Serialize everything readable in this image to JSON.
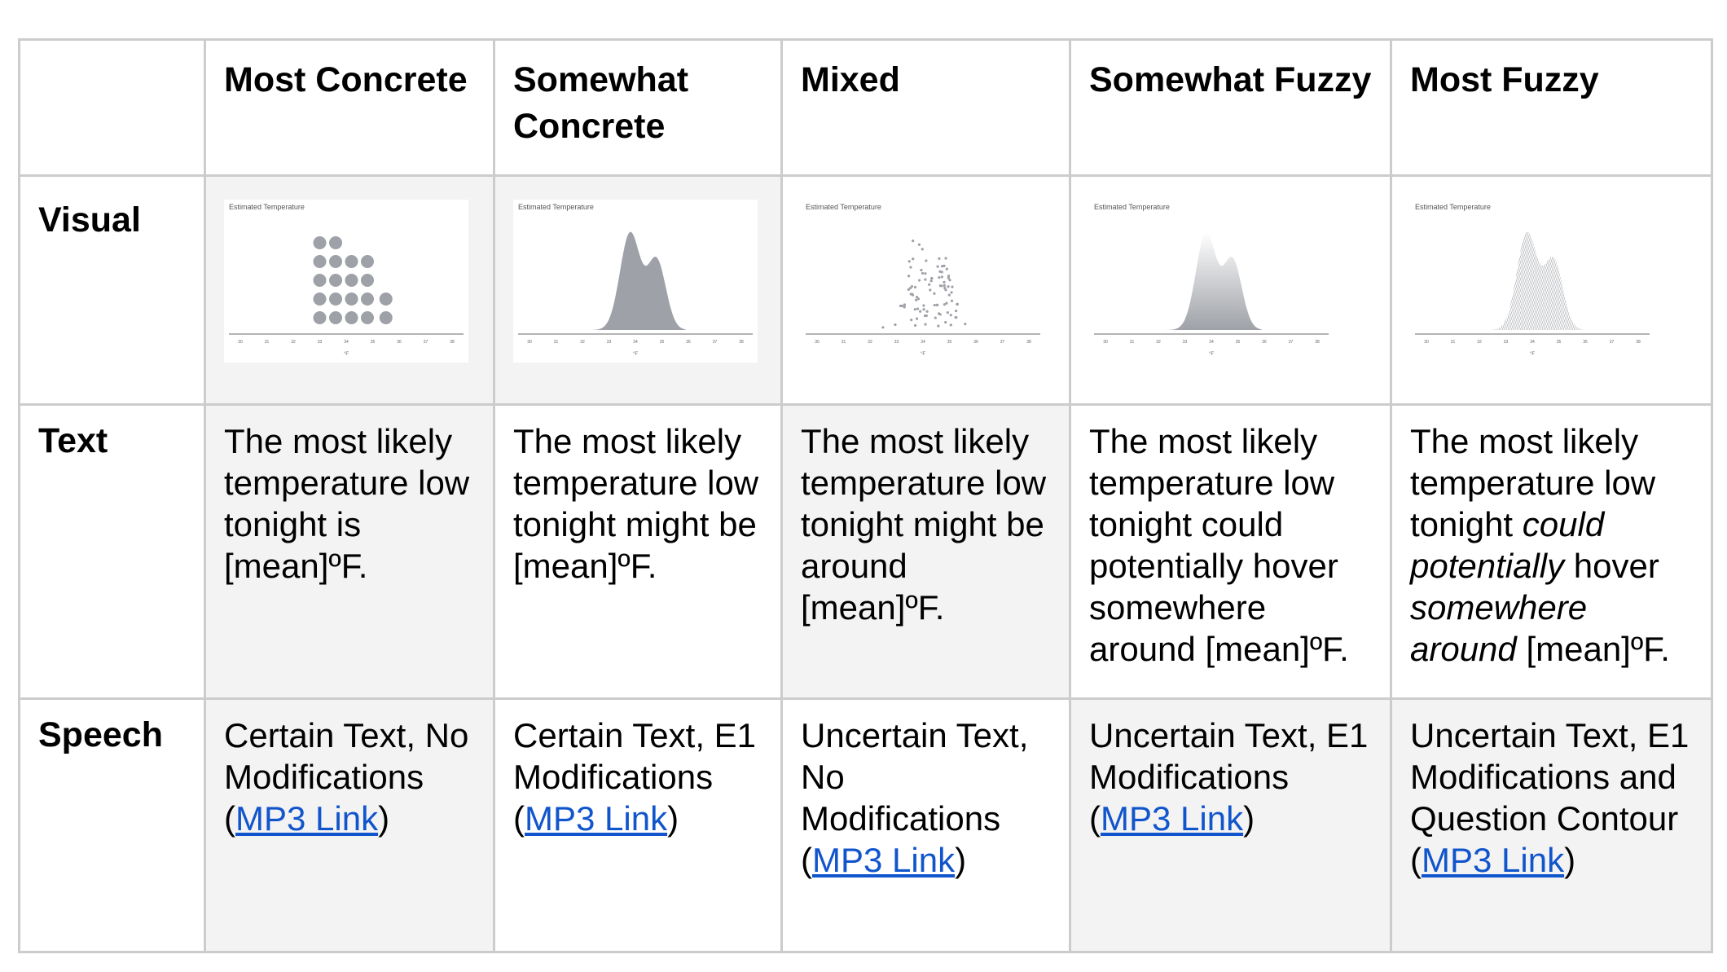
{
  "columns": [
    "Most Concrete",
    "Somewhat Concrete",
    "Mixed",
    "Somewhat Fuzzy",
    "Most Fuzzy"
  ],
  "rows": {
    "visual": "Visual",
    "text": "Text",
    "speech": "Speech"
  },
  "chart_common": {
    "title": "Estimated Temperature",
    "xlabel": "°F",
    "ticks": [
      "30",
      "31",
      "32",
      "33",
      "34",
      "35",
      "36",
      "37",
      "38"
    ],
    "xlim": [
      30,
      38
    ]
  },
  "visuals": [
    {
      "type": "dot-plot",
      "style": "solid circles",
      "color": "#9ea1a7",
      "columns": [
        {
          "x": 33.0,
          "count": 5
        },
        {
          "x": 33.6,
          "count": 5
        },
        {
          "x": 34.2,
          "count": 4
        },
        {
          "x": 34.8,
          "count": 4
        },
        {
          "x": 35.5,
          "count": 2
        }
      ]
    },
    {
      "type": "density",
      "style": "solid fill",
      "color": "#9ea1a7"
    },
    {
      "type": "scatter",
      "style": "jittered small dots",
      "color": "#9ea1a7"
    },
    {
      "type": "density",
      "style": "gradient fill",
      "color": "#9ea1a7"
    },
    {
      "type": "density",
      "style": "hatched scribble",
      "color": "#9ea1a7"
    }
  ],
  "texts": [
    [
      "The most likely temperature low tonight is [mean]ºF."
    ],
    [
      "The most likely temperature low tonight might be [mean]ºF."
    ],
    [
      "The most likely temperature low tonight might be around [mean]ºF."
    ],
    [
      "The most likely temperature low tonight could potentially hover somewhere around [mean]ºF."
    ],
    {
      "a": "The most likely temperature low tonight ",
      "i1": "could potentially",
      "b": " hover ",
      "i2": "somewhere around",
      "c": " [mean]ºF."
    }
  ],
  "speech": [
    {
      "desc": "Certain Text, No Modifications",
      "link": "MP3 Link"
    },
    {
      "desc": "Certain Text, E1 Modifications",
      "link": "MP3 Link"
    },
    {
      "desc": "Uncertain Text, No Modifications",
      "link": "MP3 Link"
    },
    {
      "desc": "Uncertain Text, E1 Modifications",
      "link": "MP3 Link"
    },
    {
      "desc": "Uncertain Text, E1 Modifications and Question Contour ",
      "link": "MP3 Link"
    }
  ],
  "colors": {
    "border": "#cccccc",
    "shaded_cell": "#f3f3f3",
    "link": "#1155cc"
  }
}
